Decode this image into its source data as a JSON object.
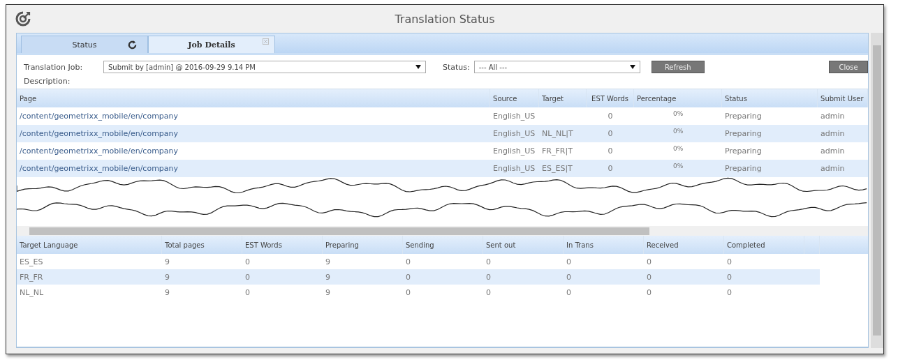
{
  "window": {
    "title": "Translation Status"
  },
  "tabs": [
    {
      "label": "Status",
      "selected": false,
      "kind": "refresh"
    },
    {
      "label": "Job Details",
      "selected": true,
      "kind": "closable"
    }
  ],
  "form": {
    "job_label": "Translation Job:",
    "job_value": "Submit by [admin] @ 2016-09-29 9.14 PM",
    "status_label": "Status:",
    "status_value": "--- All ---",
    "refresh_button": "Refresh",
    "close_button": "Close",
    "description_label": "Description:"
  },
  "pages_table": {
    "columns": [
      "Page",
      "Source",
      "Target",
      "EST Words",
      "Percentage",
      "Status",
      "Submit User"
    ],
    "rows": [
      [
        "/content/geometrixx_mobile/en/company",
        "English_US",
        "",
        "0",
        "0%",
        "Preparing",
        "admin"
      ],
      [
        "/content/geometrixx_mobile/en/company",
        "English_US",
        "NL_NL|T",
        "0",
        "0%",
        "Preparing",
        "admin"
      ],
      [
        "/content/geometrixx_mobile/en/company",
        "English_US",
        "FR_FR|T",
        "0",
        "0%",
        "Preparing",
        "admin"
      ],
      [
        "/content/geometrixx_mobile/en/company",
        "English_US",
        "ES_ES|T",
        "0",
        "0%",
        "Preparing",
        "admin"
      ]
    ]
  },
  "summary_table": {
    "columns": [
      "Target Language",
      "Total pages",
      "EST Words",
      "Preparing",
      "Sending",
      "Sent out",
      "In Trans",
      "Received",
      "Completed"
    ],
    "rows": [
      [
        "ES_ES",
        "9",
        "0",
        "9",
        "0",
        "0",
        "0",
        "0",
        "0"
      ],
      [
        "FR_FR",
        "9",
        "0",
        "9",
        "0",
        "0",
        "0",
        "0",
        "0"
      ],
      [
        "NL_NL",
        "9",
        "0",
        "9",
        "0",
        "0",
        "0",
        "0",
        "0"
      ]
    ]
  }
}
